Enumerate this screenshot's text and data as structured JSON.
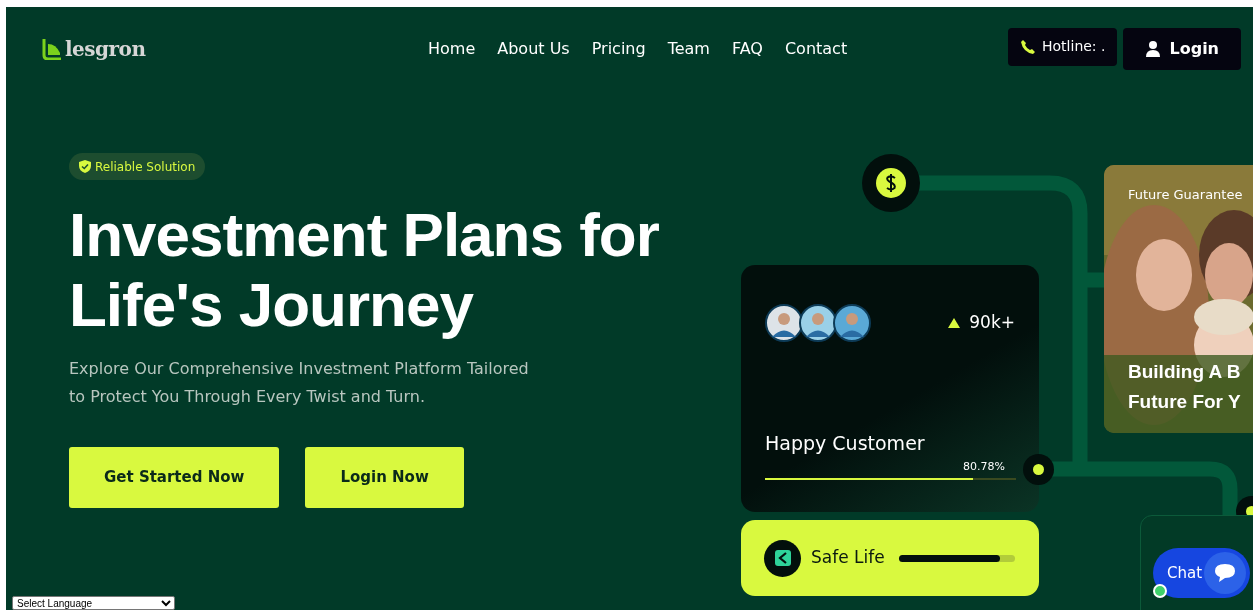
{
  "header": {
    "logo": "lesgron",
    "nav": [
      {
        "label": "Home"
      },
      {
        "label": "About Us"
      },
      {
        "label": "Pricing"
      },
      {
        "label": "Team"
      },
      {
        "label": "FAQ"
      },
      {
        "label": "Contact"
      }
    ],
    "hotline": "Hotline: .",
    "login": "Login"
  },
  "hero": {
    "badge": "Reliable Solution",
    "title_lines": [
      "Investment Plans for",
      "Life's Journey"
    ],
    "subtitle_lines": [
      "Explore Our Comprehensive Investment Platform Tailored",
      "to Protect You Through Every Twist and Turn."
    ],
    "buttons": [
      "Get Started Now",
      "Login Now"
    ]
  },
  "customer_card": {
    "count": "90k+",
    "label": "Happy Customer",
    "reading": "80.78%",
    "level": 0.83
  },
  "safe_card": {
    "label": "Safe Life",
    "level": 0.87
  },
  "photo_card": {
    "tag": "Future Guarantee",
    "caption_lines": [
      "Building A B",
      "Future For Y"
    ]
  },
  "chat": {
    "label": "Chat"
  },
  "language_select": {
    "value": "Select Language"
  }
}
